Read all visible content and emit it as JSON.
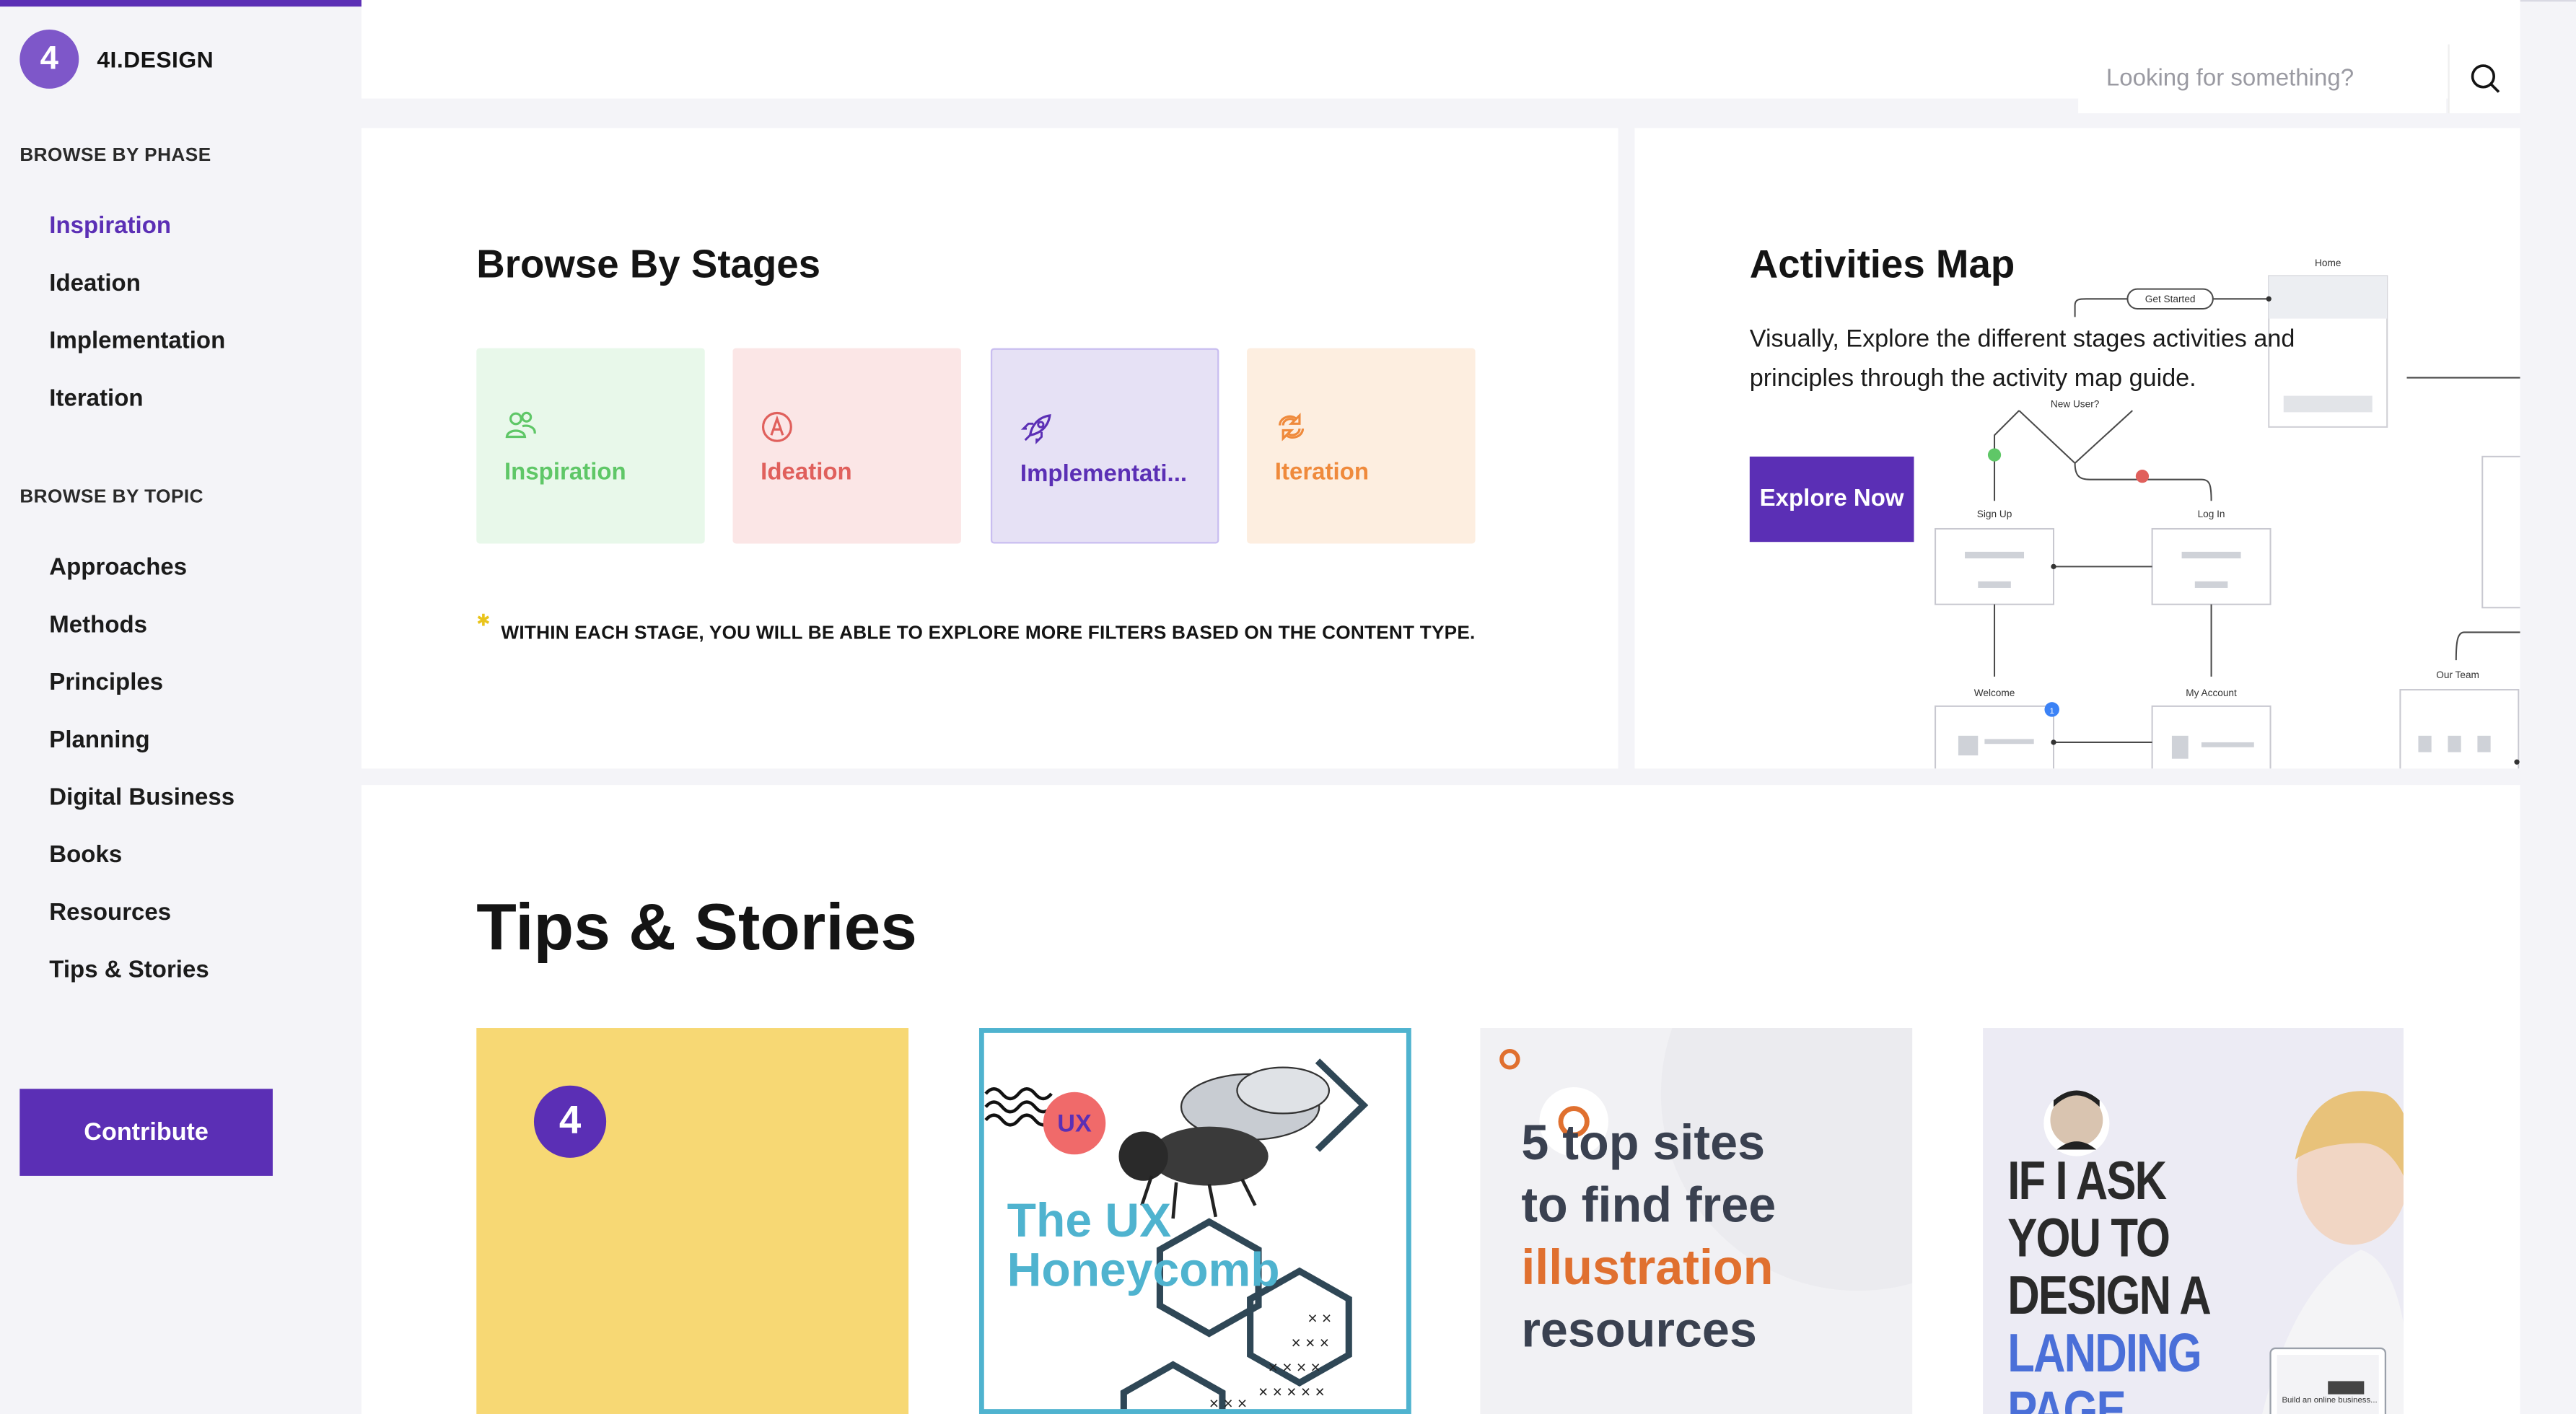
{
  "brand": {
    "name": "4I.DESIGN",
    "logo_glyph": "4"
  },
  "sidebar": {
    "phase_heading": "BROWSE BY PHASE",
    "phase_items": [
      {
        "label": "Inspiration",
        "active": true
      },
      {
        "label": "Ideation"
      },
      {
        "label": "Implementation"
      },
      {
        "label": "Iteration"
      }
    ],
    "topic_heading": "BROWSE BY TOPIC",
    "topic_items": [
      {
        "label": "Approaches"
      },
      {
        "label": "Methods"
      },
      {
        "label": "Principles"
      },
      {
        "label": "Planning"
      },
      {
        "label": "Digital Business"
      },
      {
        "label": "Books"
      },
      {
        "label": "Resources"
      },
      {
        "label": "Tips & Stories"
      }
    ],
    "contribute_label": "Contribute"
  },
  "search": {
    "placeholder": "Looking for something?",
    "icon": "search-icon"
  },
  "browse_stages": {
    "title": "Browse By Stages",
    "stages": [
      {
        "label": "Inspiration",
        "icon": "people-icon",
        "color": "#5fc767",
        "bg": "#e8f8ea"
      },
      {
        "label": "Ideation",
        "icon": "compass-icon",
        "color": "#e0605c",
        "bg": "#fbe6e6"
      },
      {
        "label": "Implementati...",
        "icon": "rocket-icon",
        "color": "#5b2fb5",
        "bg": "#e6e1f5"
      },
      {
        "label": "Iteration",
        "icon": "cycle-icon",
        "color": "#ef8a3c",
        "bg": "#fdeee0"
      }
    ],
    "note": "WITHIN EACH STAGE, YOU WILL BE ABLE TO EXPLORE MORE FILTERS BASED ON THE CONTENT TYPE."
  },
  "activities_map": {
    "title": "Activities Map",
    "description": "Visually, Explore the different stages activities and principles through the activity map guide.",
    "button": "Explore Now",
    "diagram_labels": {
      "home": "Home",
      "get_started": "Get Started",
      "new_user": "New User?",
      "sign_up": "Sign Up",
      "log_in": "Log In",
      "welcome": "Welcome",
      "my_account": "My Account",
      "our_team": "Our Team",
      "badge": "1"
    }
  },
  "tips": {
    "title": "Tips & Stories",
    "cards": [
      {
        "kind": "brand",
        "glyph": "4"
      },
      {
        "kind": "honeycomb",
        "badge": "UX",
        "line1": "The UX",
        "line2": "Honeycomb"
      },
      {
        "kind": "sites",
        "line1": "5 top sites",
        "line2": "to find free",
        "line3": "illustration",
        "line4": "resources"
      },
      {
        "kind": "landing",
        "line1": "IF I ASK",
        "line2": "YOU TO",
        "line3": "DESIGN A",
        "line4": "LANDING",
        "line5": "PAGE",
        "caption": "Build an online business..."
      }
    ]
  },
  "colors": {
    "accent": "#5b2fb5",
    "progress": "#5b2fb5"
  }
}
